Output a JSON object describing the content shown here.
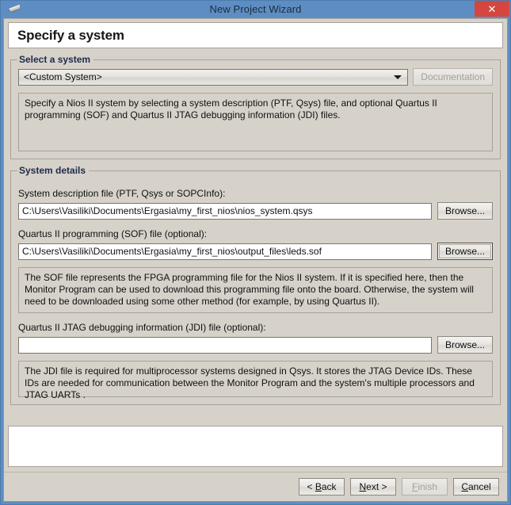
{
  "window": {
    "title": "New Project Wizard",
    "icon": "chip-icon",
    "close_label": "✕",
    "frame_color": "#5e8dc3",
    "panel_color": "#d6d2ca",
    "close_color": "#d4473f"
  },
  "header": {
    "title": "Specify a system"
  },
  "select_system": {
    "group_label": "Select a system",
    "combo": {
      "value": "<Custom System>",
      "options": [
        "<Custom System>"
      ]
    },
    "documentation_button": {
      "label": "Documentation",
      "enabled": false
    },
    "description": "Specify a Nios II system by selecting a system description (PTF, Qsys) file, and optional Quartus II programming (SOF) and Quartus II JTAG debugging information (JDI) files."
  },
  "system_details": {
    "group_label": "System details",
    "fields": [
      {
        "label": "System description file (PTF, Qsys or SOPCInfo):",
        "value": "C:\\Users\\Vasiliki\\Documents\\Ergasia\\my_first_nios\\nios_system.qsys",
        "placeholder": "",
        "browse_label": "Browse...",
        "focused": false
      },
      {
        "label": "Quartus II programming (SOF) file (optional):",
        "value": "C:\\Users\\Vasiliki\\Documents\\Ergasia\\my_first_nios\\output_files\\leds.sof",
        "placeholder": "",
        "browse_label": "Browse...",
        "focused": true
      },
      {
        "label": "Quartus II JTAG debugging information (JDI) file (optional):",
        "value": "",
        "placeholder": "",
        "browse_label": "Browse...",
        "focused": false
      }
    ],
    "sof_description": "The SOF file represents the FPGA programming file for the Nios II system. If it is specified here, then the Monitor Program can be used to download this programming file onto the board. Otherwise, the system will need to be downloaded using some other method (for example, by using Quartus II).",
    "jdi_description": "The JDI file is required for multiprocessor systems designed in Qsys. It stores the JTAG Device IDs. These IDs are needed for communication between the Monitor Program and the system's multiple processors and JTAG UARTs ."
  },
  "message_panel": {
    "text": ""
  },
  "footer": {
    "buttons": [
      {
        "name": "back",
        "prefix": "< ",
        "mnemonic": "B",
        "suffix": "ack",
        "enabled": true
      },
      {
        "name": "next",
        "prefix": "",
        "mnemonic": "N",
        "suffix": "ext >",
        "enabled": true
      },
      {
        "name": "finish",
        "prefix": "",
        "mnemonic": "F",
        "suffix": "inish",
        "enabled": false
      },
      {
        "name": "cancel",
        "prefix": "",
        "mnemonic": "C",
        "suffix": "ancel",
        "enabled": true
      }
    ]
  }
}
